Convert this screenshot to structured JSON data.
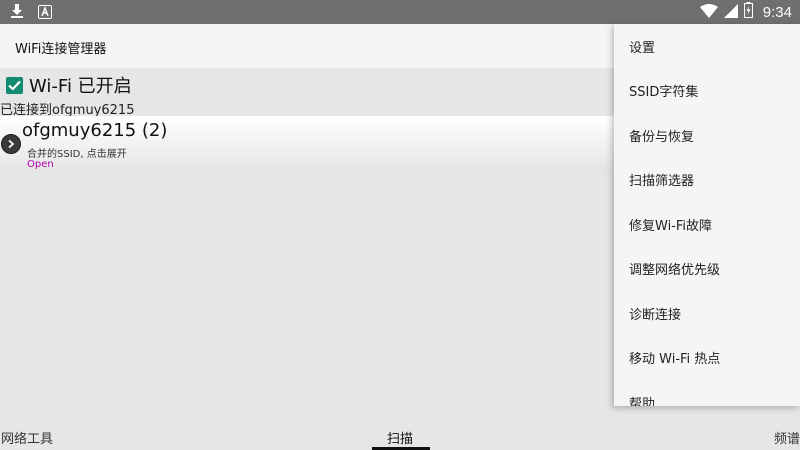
{
  "status_bar": {
    "time": "9:34",
    "icons": [
      "download-icon",
      "app-notification-icon",
      "wifi-icon",
      "signal-icon",
      "battery-icon"
    ]
  },
  "toolbar": {
    "title": "WiFi连接管理器"
  },
  "wifi": {
    "toggle_label": "Wi-Fi 已开启",
    "checked": true,
    "connected_text": "已连接到ofgmuy6215"
  },
  "network": {
    "name": "ofgmuy6215 (2)",
    "subtitle": "合并的SSID, 点击展开",
    "security": "Open",
    "security_color": "#b400b4"
  },
  "tabs": {
    "left": "网络工具",
    "center": "扫描",
    "right": "频谱"
  },
  "menu": {
    "items": [
      {
        "label": "设置"
      },
      {
        "label": "SSID字符集"
      },
      {
        "label": "备份与恢复"
      },
      {
        "label": "扫描筛选器"
      },
      {
        "label": "修复Wi-Fi故障"
      },
      {
        "label": "调整网络优先级"
      },
      {
        "label": "诊断连接"
      },
      {
        "label": "移动 Wi-Fi 热点"
      },
      {
        "label": "帮助"
      }
    ]
  },
  "colors": {
    "accent": "#138a72",
    "status_bar": "#6f6f6f"
  }
}
